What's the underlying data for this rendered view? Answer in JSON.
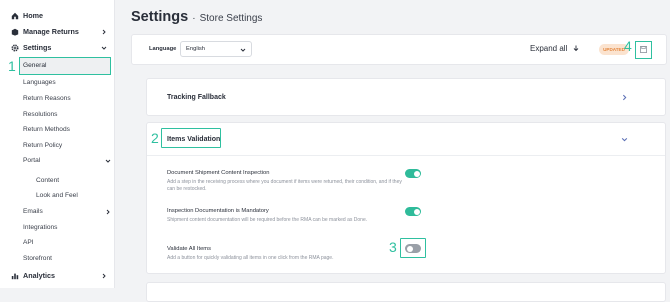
{
  "sidebar": {
    "home": "Home",
    "manage_returns": "Manage Returns",
    "settings": "Settings",
    "items": [
      "General",
      "Languages",
      "Return Reasons",
      "Resolutions",
      "Return Methods",
      "Return Policy",
      "Portal"
    ],
    "portal_items": [
      "Content",
      "Look and Feel"
    ],
    "items_after": [
      "Emails",
      "Integrations",
      "API",
      "Storefront"
    ],
    "analytics": "Analytics"
  },
  "header": {
    "title": "Settings",
    "separator": "·",
    "subtitle": "Store Settings"
  },
  "toolbar": {
    "language_label": "Language",
    "language_value": "English",
    "expand_label": "Expand all",
    "badge": "UPDATED"
  },
  "panels": {
    "tracking": "Tracking Fallback",
    "items_validation": "Items Validation"
  },
  "settings": [
    {
      "title": "Document Shipment Content Inspection",
      "desc": "Add a step in the receiving process where you document if items were returned, their condition, and if they can be restocked.",
      "on": true
    },
    {
      "title": "Inspection Documentation is Mandatory",
      "desc": "Shipment content documentation will be required before the RMA can be marked as Done.",
      "on": true
    },
    {
      "title": "Validate All Items",
      "desc": "Add a button for quickly validating all items in one click from the RMA page.",
      "on": false
    }
  ],
  "annotations": {
    "n1": "1",
    "n2": "2",
    "n3": "3",
    "n4": "4"
  },
  "colors": {
    "accent": "#2fc0a0",
    "toggle_on": "#2fbb9a",
    "toggle_off": "#9aa0a8",
    "badge_bg": "#fbe3cf",
    "badge_text": "#e4873f"
  }
}
